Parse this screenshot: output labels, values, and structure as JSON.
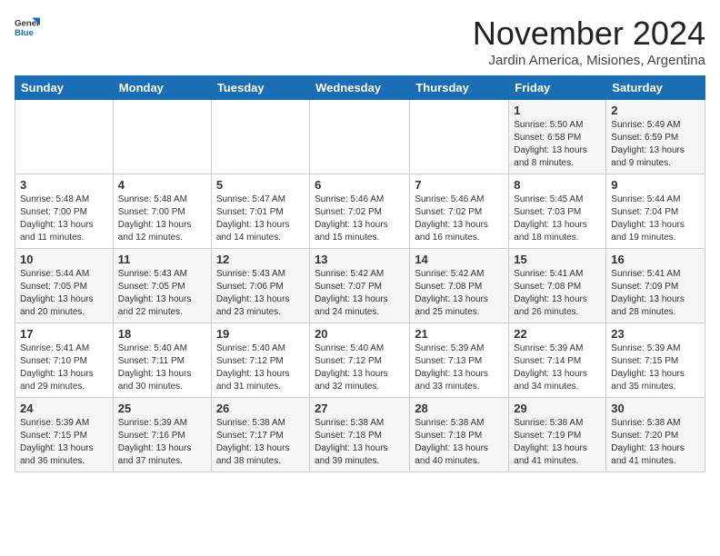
{
  "logo": {
    "line1": "General",
    "line2": "Blue"
  },
  "title": "November 2024",
  "subtitle": "Jardin America, Misiones, Argentina",
  "days_header": [
    "Sunday",
    "Monday",
    "Tuesday",
    "Wednesday",
    "Thursday",
    "Friday",
    "Saturday"
  ],
  "weeks": [
    [
      {
        "day": "",
        "info": ""
      },
      {
        "day": "",
        "info": ""
      },
      {
        "day": "",
        "info": ""
      },
      {
        "day": "",
        "info": ""
      },
      {
        "day": "",
        "info": ""
      },
      {
        "day": "1",
        "info": "Sunrise: 5:50 AM\nSunset: 6:58 PM\nDaylight: 13 hours\nand 8 minutes."
      },
      {
        "day": "2",
        "info": "Sunrise: 5:49 AM\nSunset: 6:59 PM\nDaylight: 13 hours\nand 9 minutes."
      }
    ],
    [
      {
        "day": "3",
        "info": "Sunrise: 5:48 AM\nSunset: 7:00 PM\nDaylight: 13 hours\nand 11 minutes."
      },
      {
        "day": "4",
        "info": "Sunrise: 5:48 AM\nSunset: 7:00 PM\nDaylight: 13 hours\nand 12 minutes."
      },
      {
        "day": "5",
        "info": "Sunrise: 5:47 AM\nSunset: 7:01 PM\nDaylight: 13 hours\nand 14 minutes."
      },
      {
        "day": "6",
        "info": "Sunrise: 5:46 AM\nSunset: 7:02 PM\nDaylight: 13 hours\nand 15 minutes."
      },
      {
        "day": "7",
        "info": "Sunrise: 5:46 AM\nSunset: 7:02 PM\nDaylight: 13 hours\nand 16 minutes."
      },
      {
        "day": "8",
        "info": "Sunrise: 5:45 AM\nSunset: 7:03 PM\nDaylight: 13 hours\nand 18 minutes."
      },
      {
        "day": "9",
        "info": "Sunrise: 5:44 AM\nSunset: 7:04 PM\nDaylight: 13 hours\nand 19 minutes."
      }
    ],
    [
      {
        "day": "10",
        "info": "Sunrise: 5:44 AM\nSunset: 7:05 PM\nDaylight: 13 hours\nand 20 minutes."
      },
      {
        "day": "11",
        "info": "Sunrise: 5:43 AM\nSunset: 7:05 PM\nDaylight: 13 hours\nand 22 minutes."
      },
      {
        "day": "12",
        "info": "Sunrise: 5:43 AM\nSunset: 7:06 PM\nDaylight: 13 hours\nand 23 minutes."
      },
      {
        "day": "13",
        "info": "Sunrise: 5:42 AM\nSunset: 7:07 PM\nDaylight: 13 hours\nand 24 minutes."
      },
      {
        "day": "14",
        "info": "Sunrise: 5:42 AM\nSunset: 7:08 PM\nDaylight: 13 hours\nand 25 minutes."
      },
      {
        "day": "15",
        "info": "Sunrise: 5:41 AM\nSunset: 7:08 PM\nDaylight: 13 hours\nand 26 minutes."
      },
      {
        "day": "16",
        "info": "Sunrise: 5:41 AM\nSunset: 7:09 PM\nDaylight: 13 hours\nand 28 minutes."
      }
    ],
    [
      {
        "day": "17",
        "info": "Sunrise: 5:41 AM\nSunset: 7:10 PM\nDaylight: 13 hours\nand 29 minutes."
      },
      {
        "day": "18",
        "info": "Sunrise: 5:40 AM\nSunset: 7:11 PM\nDaylight: 13 hours\nand 30 minutes."
      },
      {
        "day": "19",
        "info": "Sunrise: 5:40 AM\nSunset: 7:12 PM\nDaylight: 13 hours\nand 31 minutes."
      },
      {
        "day": "20",
        "info": "Sunrise: 5:40 AM\nSunset: 7:12 PM\nDaylight: 13 hours\nand 32 minutes."
      },
      {
        "day": "21",
        "info": "Sunrise: 5:39 AM\nSunset: 7:13 PM\nDaylight: 13 hours\nand 33 minutes."
      },
      {
        "day": "22",
        "info": "Sunrise: 5:39 AM\nSunset: 7:14 PM\nDaylight: 13 hours\nand 34 minutes."
      },
      {
        "day": "23",
        "info": "Sunrise: 5:39 AM\nSunset: 7:15 PM\nDaylight: 13 hours\nand 35 minutes."
      }
    ],
    [
      {
        "day": "24",
        "info": "Sunrise: 5:39 AM\nSunset: 7:15 PM\nDaylight: 13 hours\nand 36 minutes."
      },
      {
        "day": "25",
        "info": "Sunrise: 5:39 AM\nSunset: 7:16 PM\nDaylight: 13 hours\nand 37 minutes."
      },
      {
        "day": "26",
        "info": "Sunrise: 5:38 AM\nSunset: 7:17 PM\nDaylight: 13 hours\nand 38 minutes."
      },
      {
        "day": "27",
        "info": "Sunrise: 5:38 AM\nSunset: 7:18 PM\nDaylight: 13 hours\nand 39 minutes."
      },
      {
        "day": "28",
        "info": "Sunrise: 5:38 AM\nSunset: 7:18 PM\nDaylight: 13 hours\nand 40 minutes."
      },
      {
        "day": "29",
        "info": "Sunrise: 5:38 AM\nSunset: 7:19 PM\nDaylight: 13 hours\nand 41 minutes."
      },
      {
        "day": "30",
        "info": "Sunrise: 5:38 AM\nSunset: 7:20 PM\nDaylight: 13 hours\nand 41 minutes."
      }
    ]
  ]
}
